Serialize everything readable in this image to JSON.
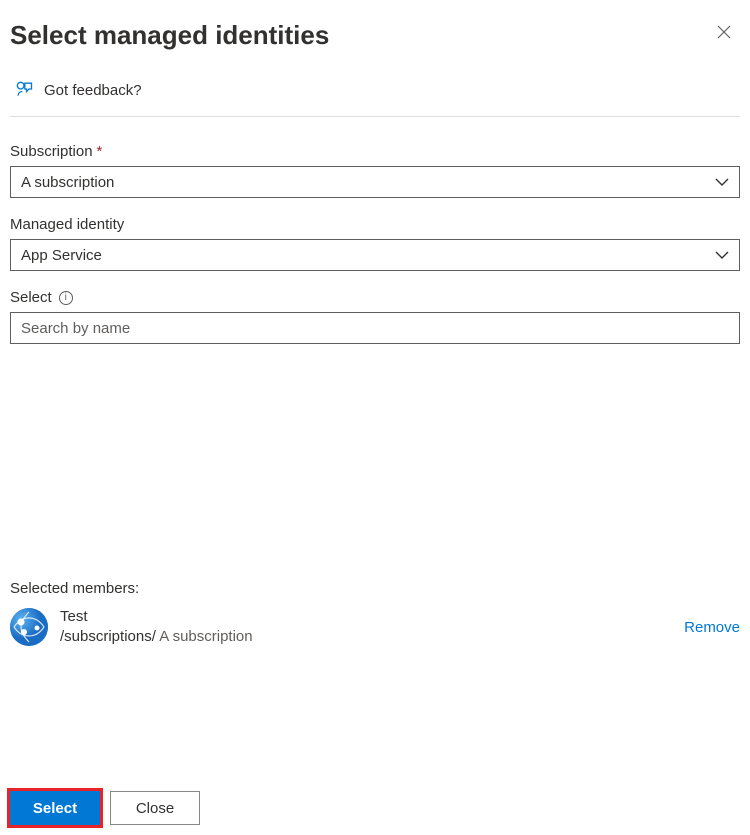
{
  "header": {
    "title": "Select managed identities"
  },
  "feedback": {
    "label": "Got feedback?"
  },
  "fields": {
    "subscription": {
      "label": "Subscription",
      "value": "A subscription"
    },
    "managed_identity": {
      "label": "Managed identity",
      "value": "App Service"
    },
    "select": {
      "label": "Select",
      "placeholder": "Search by name"
    }
  },
  "selected": {
    "heading": "Selected members:",
    "member": {
      "name": "Test",
      "path_prefix": "/subscriptions/ ",
      "path_suffix": "A subscription"
    },
    "remove_label": "Remove"
  },
  "footer": {
    "select_label": "Select",
    "close_label": "Close"
  }
}
